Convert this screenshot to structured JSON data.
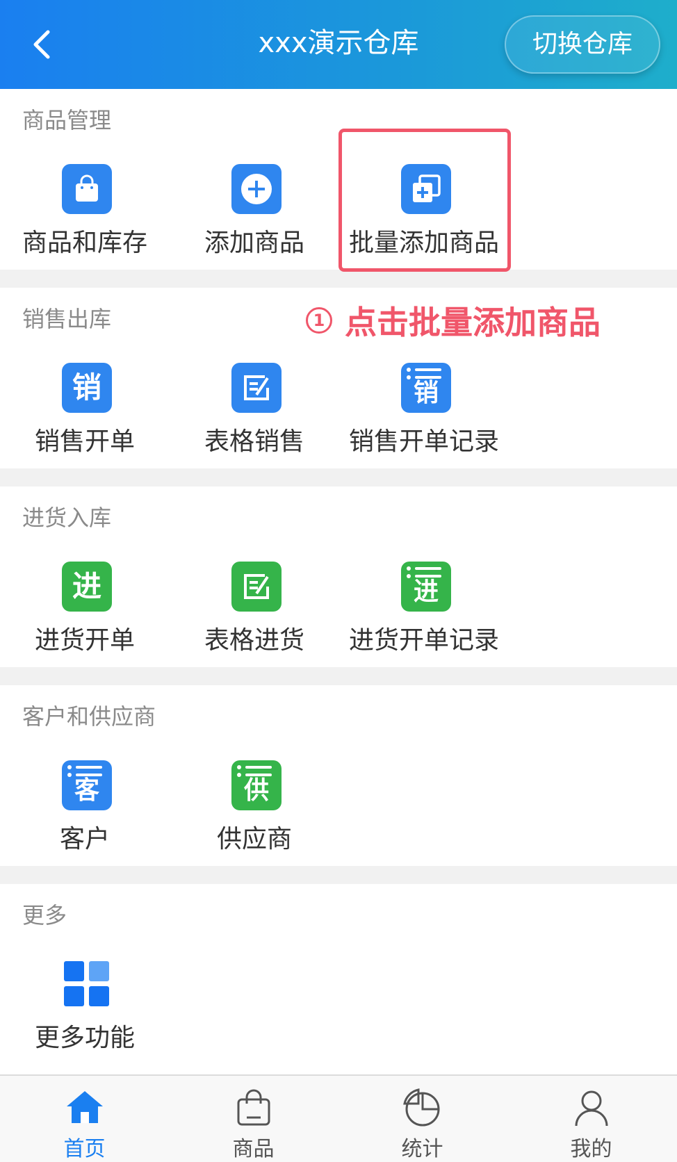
{
  "header": {
    "title": "xxx演示仓库",
    "switch_label": "切换仓库"
  },
  "sections": [
    {
      "title": "商品管理",
      "items": [
        {
          "label": "商品和库存",
          "icon": "shopping-bag-icon"
        },
        {
          "label": "添加商品",
          "icon": "plus-circle-icon"
        },
        {
          "label": "批量添加商品",
          "icon": "batch-add-icon"
        }
      ]
    },
    {
      "title": "销售出库",
      "items": [
        {
          "label": "销售开单",
          "icon": "sale-icon",
          "glyph": "销"
        },
        {
          "label": "表格销售",
          "icon": "edit-form-icon"
        },
        {
          "label": "销售开单记录",
          "icon": "sale-list-icon",
          "glyph": "销"
        }
      ]
    },
    {
      "title": "进货入库",
      "items": [
        {
          "label": "进货开单",
          "icon": "purchase-icon",
          "glyph": "进"
        },
        {
          "label": "表格进货",
          "icon": "edit-form-icon"
        },
        {
          "label": "进货开单记录",
          "icon": "purchase-list-icon",
          "glyph": "进"
        }
      ]
    },
    {
      "title": "客户和供应商",
      "items": [
        {
          "label": "客户",
          "icon": "customer-list-icon",
          "glyph": "客"
        },
        {
          "label": "供应商",
          "icon": "supplier-list-icon",
          "glyph": "供"
        }
      ]
    },
    {
      "title": "更多",
      "items": [
        {
          "label": "更多功能",
          "icon": "grid-icon"
        }
      ]
    }
  ],
  "annotation": {
    "number": "1",
    "text": "点击批量添加商品",
    "color": "#f0566a"
  },
  "tabbar": {
    "items": [
      {
        "label": "首页",
        "icon": "home-icon",
        "active": true
      },
      {
        "label": "商品",
        "icon": "shopping-bag-icon",
        "active": false
      },
      {
        "label": "统计",
        "icon": "pie-chart-icon",
        "active": false
      },
      {
        "label": "我的",
        "icon": "user-icon",
        "active": false
      }
    ]
  },
  "colors": {
    "accent": "#1a7ff0",
    "blue_icon": "#2f86ef",
    "green_icon": "#35b44a"
  }
}
